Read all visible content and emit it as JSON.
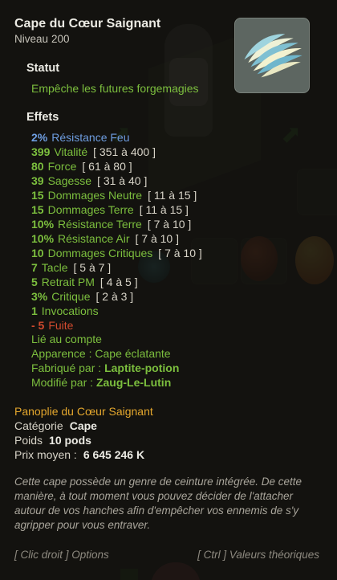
{
  "item": {
    "name": "Cape du Cœur Saignant",
    "level_label": "Niveau",
    "level_value": "200",
    "image_icon": "cape-feather-icon"
  },
  "status": {
    "title": "Statut",
    "text": "Empêche les futures forgemagies"
  },
  "effects": {
    "title": "Effets",
    "lines": [
      {
        "value": "2%",
        "name": "Résistance Feu",
        "range": "",
        "color": "blue"
      },
      {
        "value": "399",
        "name": "Vitalité",
        "range": "[ 351 à 400 ]",
        "color": "green"
      },
      {
        "value": "80",
        "name": "Force",
        "range": "[ 61 à 80 ]",
        "color": "green"
      },
      {
        "value": "39",
        "name": "Sagesse",
        "range": "[ 31 à 40 ]",
        "color": "green"
      },
      {
        "value": "15",
        "name": "Dommages Neutre",
        "range": "[ 11 à 15 ]",
        "color": "green"
      },
      {
        "value": "15",
        "name": "Dommages Terre",
        "range": "[ 11 à 15 ]",
        "color": "green"
      },
      {
        "value": "10%",
        "name": "Résistance Terre",
        "range": "[ 7 à 10 ]",
        "color": "green"
      },
      {
        "value": "10%",
        "name": "Résistance Air",
        "range": "[ 7 à 10 ]",
        "color": "green"
      },
      {
        "value": "10",
        "name": "Dommages Critiques",
        "range": "[ 7 à 10 ]",
        "color": "green"
      },
      {
        "value": "7",
        "name": "Tacle",
        "range": "[ 5 à 7 ]",
        "color": "green"
      },
      {
        "value": "5",
        "name": "Retrait PM",
        "range": "[ 4 à 5 ]",
        "color": "green"
      },
      {
        "value": "3%",
        "name": "Critique",
        "range": "[ 2 à 3 ]",
        "color": "green"
      },
      {
        "value": "1",
        "name": "Invocations",
        "range": "",
        "color": "green"
      },
      {
        "value": "- 5",
        "name": "Fuite",
        "range": "",
        "color": "red"
      }
    ],
    "account_bound": "Lié au compte",
    "appearance": "Apparence : Cape éclatante",
    "crafted_label": "Fabriqué par :",
    "crafted_by": "Laptite-potion",
    "modified_label": "Modifié par :",
    "modified_by": "Zaug-Le-Lutin"
  },
  "details": {
    "set_name": "Panoplie du Cœur Saignant",
    "category_label": "Catégorie",
    "category_value": "Cape",
    "weight_label": "Poids",
    "weight_value": "10 pods",
    "price_label": "Prix moyen :",
    "price_value": "6 645 246 K"
  },
  "description": "Cette cape possède un genre de ceinture intégrée. De cette manière, à tout moment vous pouvez décider de l'attacher autour de vos hanches afin d'empêcher vos ennemis de s'y agripper pour vous entraver.",
  "footer": {
    "right_click": "[ Clic droit ] Options",
    "ctrl": "[ Ctrl ] Valeurs théoriques"
  },
  "colors": {
    "green": "#7cbf3e",
    "blue": "#6e9de0",
    "red": "#d04a2e",
    "gold": "#e4a72d"
  }
}
